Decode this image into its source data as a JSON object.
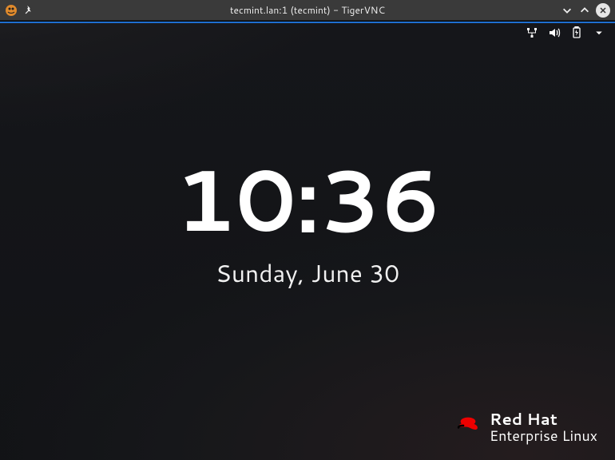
{
  "window": {
    "title": "tecmint.lan:1 (tecmint) - TigerVNC",
    "icons": {
      "app": "tigervnc-icon",
      "pin": "pin-icon",
      "min": "chevron-down-icon",
      "max": "chevron-up-icon",
      "close": "close-icon"
    }
  },
  "panel": {
    "network_icon": "network-wired-icon",
    "sound_icon": "volume-icon",
    "battery_icon": "battery-charging-icon",
    "menu_icon": "caret-down-icon"
  },
  "lock": {
    "time": "10:36",
    "date": "Sunday, June 30"
  },
  "brand": {
    "name_top": "Red Hat",
    "name_bottom": "Enterprise Linux",
    "hat_icon": "redhat-icon",
    "accent": "#ee0000"
  }
}
